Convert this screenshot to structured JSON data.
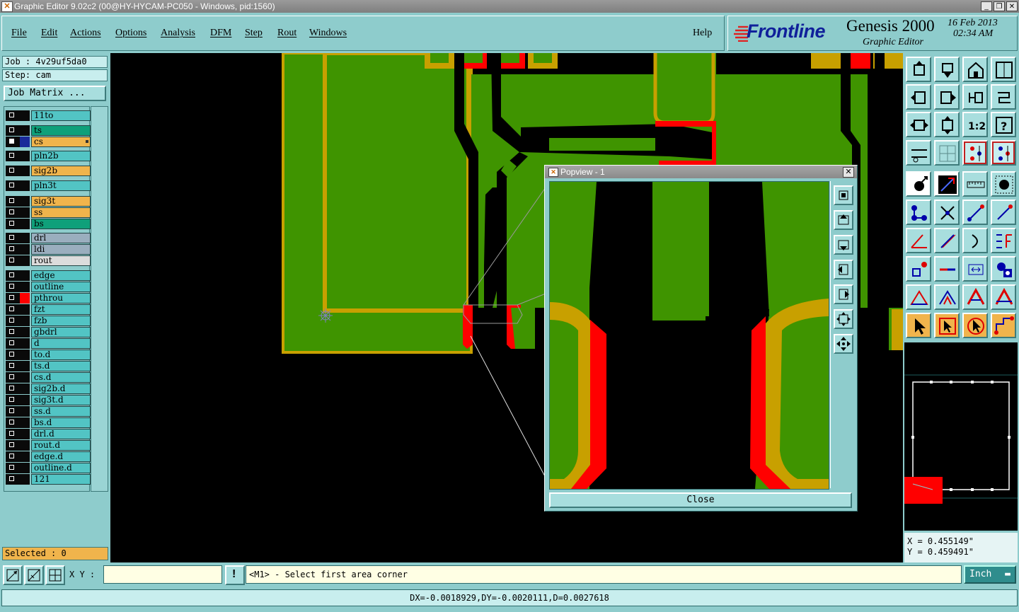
{
  "window": {
    "title": "Graphic Editor 9.02c2 (00@HY-HYCAM-PC050 - Windows, pid:1560)",
    "buttons": [
      "_",
      "❐",
      "✕"
    ]
  },
  "menu": [
    "File",
    "Edit",
    "Actions",
    "Options",
    "Analysis",
    "DFM",
    "Step",
    "Rout",
    "Windows"
  ],
  "help_label": "Help",
  "brand": {
    "logo": "Frontline",
    "product": "Genesis 2000",
    "subtitle": "Graphic Editor",
    "date": "16 Feb 2013",
    "time": "02:34 AM"
  },
  "job": "Job : 4v29uf5da0",
  "step": "Step: cam",
  "job_matrix_label": "Job Matrix ...",
  "layers": [
    {
      "name": "11to",
      "color": "#52c4c4",
      "checked": false
    },
    {
      "name": "ts",
      "color": "#0fa07a",
      "checked": false
    },
    {
      "name": "cs",
      "color": "#f0b44c",
      "checked": true,
      "active": true
    },
    {
      "name": "pln2b",
      "color": "#52c4c4",
      "checked": false
    },
    {
      "name": "sig2b",
      "color": "#f0b44c",
      "checked": false
    },
    {
      "name": "pln3t",
      "color": "#52c4c4",
      "checked": false
    },
    {
      "name": "sig3t",
      "color": "#f0b44c",
      "checked": false
    },
    {
      "name": "ss",
      "color": "#f0b44c",
      "checked": false
    },
    {
      "name": "bs",
      "color": "#0fa07a",
      "checked": false
    },
    {
      "name": "drl",
      "color": "#9aaebe",
      "checked": false
    },
    {
      "name": "ldi",
      "color": "#9aaebe",
      "checked": false
    },
    {
      "name": "rout",
      "color": "#dcdcdc",
      "checked": false
    },
    {
      "name": "edge",
      "color": "#52c4c4",
      "checked": false
    },
    {
      "name": "outline",
      "color": "#52c4c4",
      "checked": false
    },
    {
      "name": "pthrou",
      "color": "#52c4c4",
      "checked": false,
      "marked": true
    },
    {
      "name": "fzt",
      "color": "#52c4c4",
      "checked": false
    },
    {
      "name": "fzb",
      "color": "#52c4c4",
      "checked": false
    },
    {
      "name": "gbdrl",
      "color": "#52c4c4",
      "checked": false
    },
    {
      "name": "d",
      "color": "#52c4c4",
      "checked": false
    },
    {
      "name": "to.d",
      "color": "#52c4c4",
      "checked": false
    },
    {
      "name": "ts.d",
      "color": "#52c4c4",
      "checked": false
    },
    {
      "name": "cs.d",
      "color": "#52c4c4",
      "checked": false
    },
    {
      "name": "sig2b.d",
      "color": "#52c4c4",
      "checked": false
    },
    {
      "name": "sig3t.d",
      "color": "#52c4c4",
      "checked": false
    },
    {
      "name": "ss.d",
      "color": "#52c4c4",
      "checked": false
    },
    {
      "name": "bs.d",
      "color": "#52c4c4",
      "checked": false
    },
    {
      "name": "drl.d",
      "color": "#52c4c4",
      "checked": false
    },
    {
      "name": "rout.d",
      "color": "#52c4c4",
      "checked": false
    },
    {
      "name": "edge.d",
      "color": "#52c4c4",
      "checked": false
    },
    {
      "name": "outline.d",
      "color": "#52c4c4",
      "checked": false
    },
    {
      "name": "121",
      "color": "#52c4c4",
      "checked": false
    }
  ],
  "selected": "Selected : 0",
  "popview": {
    "title": "Popview - 1",
    "close_label": "Close"
  },
  "toolbar_icons": [
    "zoom-home-icon",
    "zoom-down-icon",
    "home-icon",
    "panel-icon",
    "pan-left-icon",
    "pan-right-icon",
    "route-icon",
    "snake-icon",
    "fit-icon",
    "fit-profile-icon",
    "one-to-one-icon",
    "help-icon",
    "tools-icon",
    "grid-icon",
    "net-icon",
    "net-alt-icon",
    "add-feature-icon",
    "measure-line-icon",
    "ruler-icon",
    "pad-icon",
    "connect-icon",
    "cross-icon",
    "line-icon",
    "line-alt-icon",
    "angle-icon",
    "slash-icon",
    "arc-icon",
    "text-icon",
    "move-icon",
    "split-icon",
    "dimension-icon",
    "shapes-icon",
    "triangle-icon",
    "triangle-a-icon",
    "triangle-b-icon",
    "triangle-c-icon",
    "select-icon",
    "select-box-icon",
    "select-cursor-icon",
    "path-icon"
  ],
  "coords": {
    "x": "X = 0.455149\"",
    "y": "Y = 0.459491\""
  },
  "command": {
    "xy_label": "X Y :",
    "xy_value": "",
    "message": "<M1> - Select first area corner",
    "units": "Inch"
  },
  "status": "DX=-0.0018929,DY=-0.0020111,D=0.0027618",
  "colors": {
    "panel": "#8ecccc",
    "copper": "#3f9400",
    "gold": "#c8a000",
    "red": "#ff0000",
    "canvas": "#000000"
  }
}
